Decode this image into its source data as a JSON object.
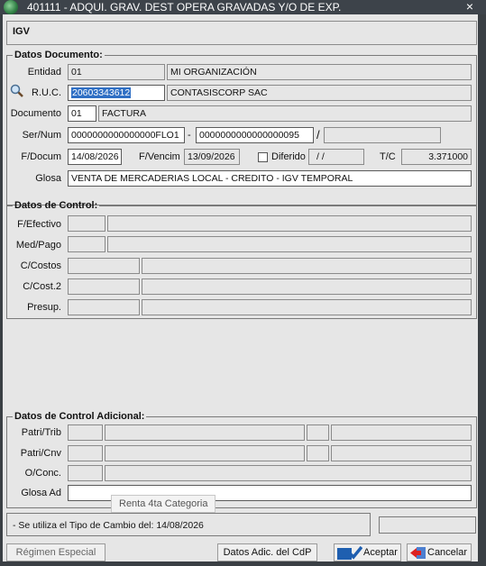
{
  "window": {
    "title": "401111 - ADQUI. GRAV. DEST OPERA GRAVADAS Y/O DE EXP.",
    "close": "×"
  },
  "header": {
    "label": "IGV"
  },
  "doc": {
    "legend": "Datos Documento:",
    "entidad_label": "Entidad",
    "entidad_code": "01",
    "entidad_name": "MI ORGANIZACIÓN",
    "ruc_label": "R.U.C.",
    "ruc_value": "20603343612",
    "ruc_name": "CONTASISCORP SAC",
    "documento_label": "Documento",
    "documento_code": "01",
    "documento_name": "FACTURA",
    "sernum_label": "Ser/Num",
    "serie": "0000000000000000FLO1",
    "dash": "-",
    "numero": "0000000000000000095",
    "slash": "/",
    "extra": "",
    "fdocum_label": "F/Docum",
    "fdocum": "14/08/2026",
    "fvencim_label": "F/Vencim",
    "fvencim": "13/09/2026",
    "diferido_label": "Diferido",
    "diferido_value": "/ /",
    "tc_label": "T/C",
    "tc_value": "3.371000",
    "glosa_label": "Glosa",
    "glosa_value": "VENTA DE MERCADERIAS LOCAL - CREDITO - IGV TEMPORAL"
  },
  "control": {
    "legend": "Datos de Control:",
    "fefectivo_label": "F/Efectivo",
    "medpago_label": "Med/Pago",
    "ccostos_label": "C/Costos",
    "ccost2_label": "C/Cost.2",
    "presup_label": "Presup."
  },
  "control_adic": {
    "legend": "Datos de Control Adicional:",
    "patritrib_label": "Patri/Trib",
    "patricnv_label": "Patri/Cnv",
    "oconc_label": "O/Conc.",
    "glosaad_label": "Glosa Ad",
    "glosaad_value": ""
  },
  "tooltip": "Renta 4ta Categoria",
  "status": {
    "message": "- Se utiliza el Tipo de Cambio del: 14/08/2026"
  },
  "footer": {
    "regimen": "Régimen Especial",
    "datos_adic": "Datos Adic. del CdP",
    "aceptar": "Aceptar",
    "cancelar": "Cancelar"
  }
}
